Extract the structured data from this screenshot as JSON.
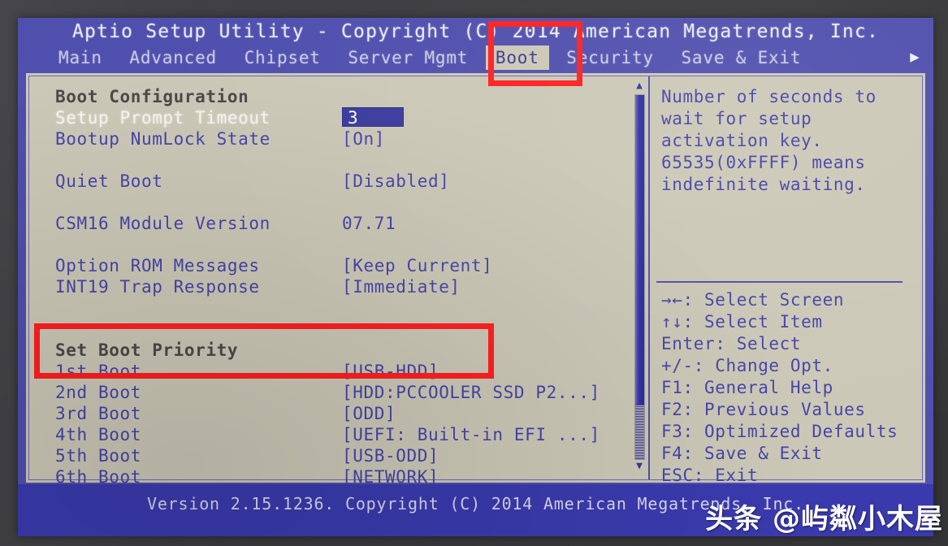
{
  "header": {
    "title": "Aptio Setup Utility - Copyright (C) 2014 American Megatrends, Inc.",
    "tabs": [
      {
        "label": "Main",
        "active": false
      },
      {
        "label": "Advanced",
        "active": false
      },
      {
        "label": "Chipset",
        "active": false
      },
      {
        "label": "Server Mgmt",
        "active": false
      },
      {
        "label": "Boot",
        "active": true
      },
      {
        "label": "Security",
        "active": false
      },
      {
        "label": "Save & Exit",
        "active": false
      }
    ],
    "more_icon": "▶"
  },
  "settings": {
    "rows": [
      {
        "label": "Boot Configuration",
        "value": "",
        "type": "group"
      },
      {
        "label": "Setup Prompt Timeout",
        "value": "3",
        "type": "input",
        "selected": true
      },
      {
        "label": "Bootup NumLock State",
        "value": "[On]",
        "type": "option"
      },
      {
        "label": "",
        "value": "",
        "type": "spacer"
      },
      {
        "label": "Quiet Boot",
        "value": "[Disabled]",
        "type": "option"
      },
      {
        "label": "",
        "value": "",
        "type": "spacer"
      },
      {
        "label": "CSM16 Module Version",
        "value": "07.71",
        "type": "static"
      },
      {
        "label": "",
        "value": "",
        "type": "spacer"
      },
      {
        "label": "Option ROM Messages",
        "value": "[Keep Current]",
        "type": "option"
      },
      {
        "label": "INT19 Trap Response",
        "value": "[Immediate]",
        "type": "option"
      },
      {
        "label": "",
        "value": "",
        "type": "spacer"
      },
      {
        "label": "",
        "value": "",
        "type": "spacer"
      },
      {
        "label": "Set Boot Priority",
        "value": "",
        "type": "group"
      },
      {
        "label": "1st Boot",
        "value": "[USB-HDD]",
        "type": "option"
      },
      {
        "label": "2nd Boot",
        "value": "[HDD:PCCOOLER SSD P2...]",
        "type": "option"
      },
      {
        "label": "3rd Boot",
        "value": "[ODD]",
        "type": "option"
      },
      {
        "label": "4th Boot",
        "value": "[UEFI: Built-in EFI ...]",
        "type": "option"
      },
      {
        "label": "5th Boot",
        "value": "[USB-ODD]",
        "type": "option"
      },
      {
        "label": "6th Boot",
        "value": "[NETWORK]",
        "type": "option"
      }
    ]
  },
  "scrollbar": {
    "up_icon": "▲",
    "down_icon": "▼",
    "thumb_percent": 85
  },
  "help": {
    "description": [
      "Number of seconds to",
      "wait for setup",
      "activation key.",
      "65535(0xFFFF) means",
      "indefinite waiting."
    ],
    "keys": [
      "→←: Select Screen",
      "↑↓: Select Item",
      "Enter: Select",
      "+/-: Change Opt.",
      "F1: General Help",
      "F2: Previous Values",
      "F3: Optimized Defaults",
      "F4: Save & Exit",
      "ESC: Exit"
    ]
  },
  "footer": {
    "version_text": "Version 2.15.1236. Copyright (C) 2014 American Megatrends, Inc."
  },
  "watermark": {
    "text": "头条 @屿粼小木屋"
  },
  "annotations": {
    "boot_tab_highlight": "Boot",
    "priority_highlight": "Set Boot Priority / 1st Boot"
  },
  "colors": {
    "header_blue": "#4f4fae",
    "content_bg": "#ccc8b7",
    "text_blue": "#4545a8",
    "selected_white": "#f5f5f0",
    "input_box": "#3b3b9e",
    "annotation_red": "#ff1f1f"
  }
}
